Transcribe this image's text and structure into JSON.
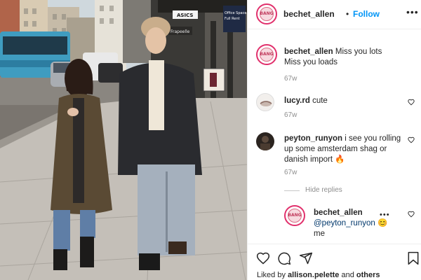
{
  "post": {
    "author": "bechet_allen",
    "follow_label": "Follow",
    "separator": "•",
    "avatar_text": "BANG"
  },
  "photo": {
    "signs": [
      "Office Space",
      "Full Rent",
      "ASICS",
      "Frapeelle"
    ]
  },
  "comments": [
    {
      "user": "bechet_allen",
      "text": "Miss you lots\nMiss you loads",
      "time": "67w",
      "avatar": "logo"
    },
    {
      "user": "lucy.rd",
      "text": "cute",
      "time": "67w",
      "avatar": "photo"
    },
    {
      "user": "peyton_runyon",
      "text": "i see you rolling up some amsterdam shag or danish import 🔥",
      "time": "67w",
      "avatar": "photo-dark"
    }
  ],
  "hide_replies": "Hide replies",
  "reply": {
    "user": "bechet_allen",
    "mention": "@peyton_runyon",
    "emoji": "😊",
    "text_tail": "me",
    "more": "•••"
  },
  "actions": {
    "icons": [
      "heart-icon",
      "comment-icon",
      "share-icon",
      "bookmark-icon"
    ],
    "liked_prefix": "Liked by",
    "liked_user": "allison.pelette",
    "liked_and": "and",
    "liked_others": "others"
  },
  "colors": {
    "link_blue": "#0095f6",
    "mention_blue": "#00376b",
    "muted": "#8e8e8e",
    "avatar_ring": "#e1306c"
  }
}
